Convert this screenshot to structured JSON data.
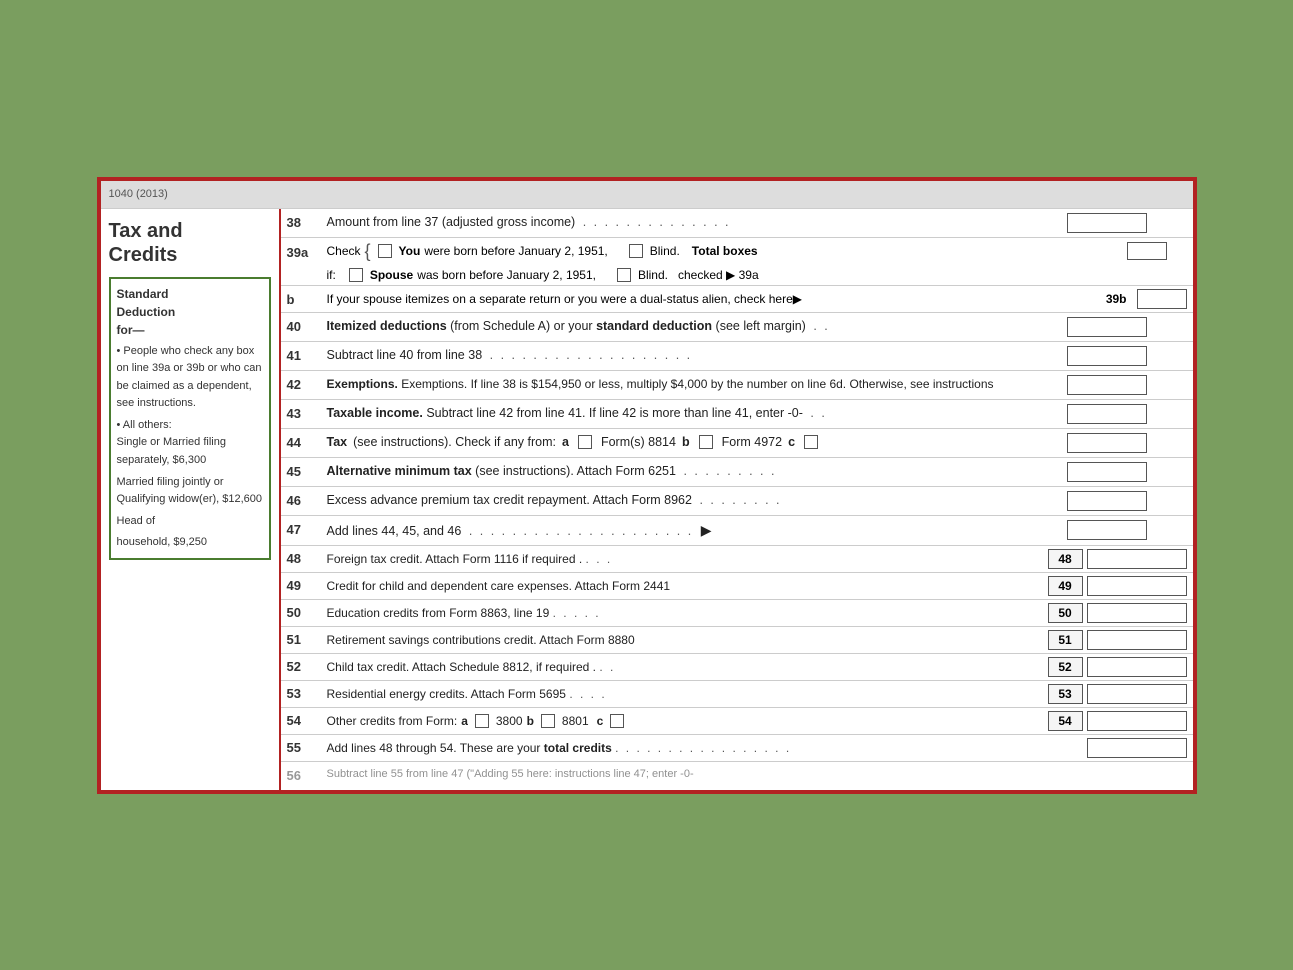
{
  "page": {
    "topbar_text": "1040 (2013)",
    "background_color": "#7a9e5f",
    "border_color": "#b22222"
  },
  "sidebar": {
    "title_line1": "Tax and",
    "title_line2": "Credits",
    "standard_deduction": {
      "title": "Standard",
      "subtitle": "Deduction",
      "for_label": "for—",
      "items": [
        "• People who check any box on line 39a or 39b or who can be claimed as a dependent, see instructions.",
        "• All others:",
        "Single or Married filing separately, $6,300",
        "Married filing jointly or Qualifying widow(er), $12,600",
        "Head of household, $9,250"
      ]
    }
  },
  "lines": {
    "line38": {
      "num": "38",
      "text": "Amount from line 37 (adjusted gross income)",
      "dots": ". . . . . . . . . . . . . ."
    },
    "line39a": {
      "num": "39a",
      "check_label": "Check",
      "you_label": "You",
      "you_text": "were born before January 2, 1951,",
      "blind_label1": "Blind.",
      "total_boxes_label": "Total boxes",
      "if_label": "if:",
      "spouse_label": "Spouse",
      "spouse_text": "was born before January 2, 1951,",
      "blind_label2": "Blind.",
      "checked_label": "checked ▶ 39a"
    },
    "line39b": {
      "num": "b",
      "text": "If your spouse itemizes on a separate return or you were a dual-status alien,  check here▶",
      "label": "39b"
    },
    "line40": {
      "num": "40",
      "text1": "Itemized deductions",
      "text2": " (from Schedule A) ",
      "text3": "or",
      "text4": " your ",
      "text5": "standard deduction",
      "text6": " (see left margin)",
      "dots": ". ."
    },
    "line41": {
      "num": "41",
      "text": "Subtract line 40 from line 38",
      "dots": ". . . . . . . . . . . . . . . . . . ."
    },
    "line42": {
      "num": "42",
      "text": "Exemptions. If line 38 is $154,950 or less, multiply $4,000 by the number on line 6d. Otherwise, see instructions"
    },
    "line43": {
      "num": "43",
      "text1": "Taxable income.",
      "text2": " Subtract line 42 from line 41. If line 42 is more than line 41, enter -0-",
      "dots": ". ."
    },
    "line44": {
      "num": "44",
      "text_pre": "Tax",
      "text_instructions": "  (see instructions). Check if any from:",
      "a_label": "a",
      "form_8814": "Form(s) 8814",
      "b_label": "b",
      "form_4972": "Form 4972",
      "c_label": "c"
    },
    "line45": {
      "num": "45",
      "text1": "Alternative minimum tax",
      "text2": "  (see instructions). Attach Form 6251",
      "dots": ". . . . . . . . ."
    },
    "line46": {
      "num": "46",
      "text": "Excess advance premium tax credit repayment. Attach Form 8962",
      "dots": ". . . . . . . ."
    },
    "line47": {
      "num": "47",
      "text": "Add lines 44, 45, and 46",
      "dots": ". . . . . . . . . . . . . . . . . . . . .",
      "arrow": "▶"
    },
    "line48": {
      "num": "48",
      "text": "Foreign tax credit. Attach Form 1116 if required .",
      "dots": ". . .",
      "box_num": "48"
    },
    "line49": {
      "num": "49",
      "text": "Credit for child and dependent care expenses. Attach Form 2441",
      "box_num": "49"
    },
    "line50": {
      "num": "50",
      "text": "Education credits from Form 8863, line 19",
      "dots": ". . . . .",
      "box_num": "50"
    },
    "line51": {
      "num": "51",
      "text": "Retirement savings contributions credit. Attach Form 8880",
      "box_num": "51"
    },
    "line52": {
      "num": "52",
      "text": "Child tax credit. Attach Schedule 8812, if required .",
      "dots": ". .",
      "box_num": "52"
    },
    "line53": {
      "num": "53",
      "text": "Residential energy credits. Attach Form 5695",
      "dots": ". . . .",
      "box_num": "53"
    },
    "line54": {
      "num": "54",
      "text_pre": "Other credits from Form:",
      "a_label": "a",
      "val_3800": "3800",
      "b_label": "b",
      "val_8801": "8801",
      "c_label": "c",
      "box_num": "54"
    },
    "line55": {
      "num": "55",
      "text1": "Add lines 48 through 54. These are your ",
      "text2": "total credits",
      "dots": ". . . . . . . . . . . . . . . . ."
    },
    "line56_partial": {
      "num": "56",
      "text_partial": "Subtract line 55 from line 47 (\"Adding 55 here: instructions line 47; enter -0-"
    }
  }
}
